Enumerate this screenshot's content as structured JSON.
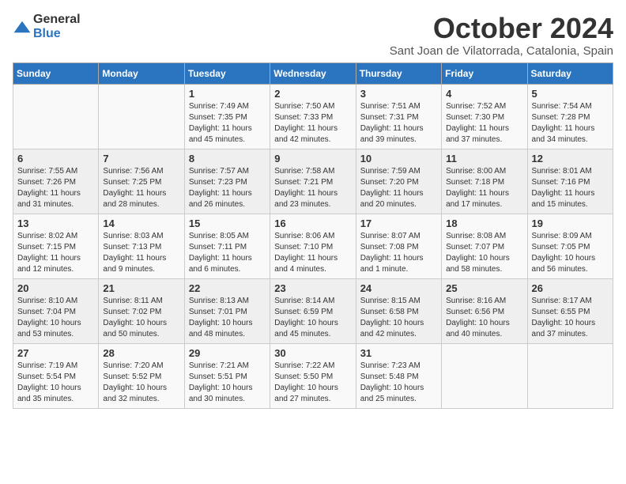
{
  "logo": {
    "general": "General",
    "blue": "Blue"
  },
  "header": {
    "month": "October 2024",
    "location": "Sant Joan de Vilatorrada, Catalonia, Spain"
  },
  "days_of_week": [
    "Sunday",
    "Monday",
    "Tuesday",
    "Wednesday",
    "Thursday",
    "Friday",
    "Saturday"
  ],
  "weeks": [
    [
      {
        "day": "",
        "detail": ""
      },
      {
        "day": "",
        "detail": ""
      },
      {
        "day": "1",
        "detail": "Sunrise: 7:49 AM\nSunset: 7:35 PM\nDaylight: 11 hours and 45 minutes."
      },
      {
        "day": "2",
        "detail": "Sunrise: 7:50 AM\nSunset: 7:33 PM\nDaylight: 11 hours and 42 minutes."
      },
      {
        "day": "3",
        "detail": "Sunrise: 7:51 AM\nSunset: 7:31 PM\nDaylight: 11 hours and 39 minutes."
      },
      {
        "day": "4",
        "detail": "Sunrise: 7:52 AM\nSunset: 7:30 PM\nDaylight: 11 hours and 37 minutes."
      },
      {
        "day": "5",
        "detail": "Sunrise: 7:54 AM\nSunset: 7:28 PM\nDaylight: 11 hours and 34 minutes."
      }
    ],
    [
      {
        "day": "6",
        "detail": "Sunrise: 7:55 AM\nSunset: 7:26 PM\nDaylight: 11 hours and 31 minutes."
      },
      {
        "day": "7",
        "detail": "Sunrise: 7:56 AM\nSunset: 7:25 PM\nDaylight: 11 hours and 28 minutes."
      },
      {
        "day": "8",
        "detail": "Sunrise: 7:57 AM\nSunset: 7:23 PM\nDaylight: 11 hours and 26 minutes."
      },
      {
        "day": "9",
        "detail": "Sunrise: 7:58 AM\nSunset: 7:21 PM\nDaylight: 11 hours and 23 minutes."
      },
      {
        "day": "10",
        "detail": "Sunrise: 7:59 AM\nSunset: 7:20 PM\nDaylight: 11 hours and 20 minutes."
      },
      {
        "day": "11",
        "detail": "Sunrise: 8:00 AM\nSunset: 7:18 PM\nDaylight: 11 hours and 17 minutes."
      },
      {
        "day": "12",
        "detail": "Sunrise: 8:01 AM\nSunset: 7:16 PM\nDaylight: 11 hours and 15 minutes."
      }
    ],
    [
      {
        "day": "13",
        "detail": "Sunrise: 8:02 AM\nSunset: 7:15 PM\nDaylight: 11 hours and 12 minutes."
      },
      {
        "day": "14",
        "detail": "Sunrise: 8:03 AM\nSunset: 7:13 PM\nDaylight: 11 hours and 9 minutes."
      },
      {
        "day": "15",
        "detail": "Sunrise: 8:05 AM\nSunset: 7:11 PM\nDaylight: 11 hours and 6 minutes."
      },
      {
        "day": "16",
        "detail": "Sunrise: 8:06 AM\nSunset: 7:10 PM\nDaylight: 11 hours and 4 minutes."
      },
      {
        "day": "17",
        "detail": "Sunrise: 8:07 AM\nSunset: 7:08 PM\nDaylight: 11 hours and 1 minute."
      },
      {
        "day": "18",
        "detail": "Sunrise: 8:08 AM\nSunset: 7:07 PM\nDaylight: 10 hours and 58 minutes."
      },
      {
        "day": "19",
        "detail": "Sunrise: 8:09 AM\nSunset: 7:05 PM\nDaylight: 10 hours and 56 minutes."
      }
    ],
    [
      {
        "day": "20",
        "detail": "Sunrise: 8:10 AM\nSunset: 7:04 PM\nDaylight: 10 hours and 53 minutes."
      },
      {
        "day": "21",
        "detail": "Sunrise: 8:11 AM\nSunset: 7:02 PM\nDaylight: 10 hours and 50 minutes."
      },
      {
        "day": "22",
        "detail": "Sunrise: 8:13 AM\nSunset: 7:01 PM\nDaylight: 10 hours and 48 minutes."
      },
      {
        "day": "23",
        "detail": "Sunrise: 8:14 AM\nSunset: 6:59 PM\nDaylight: 10 hours and 45 minutes."
      },
      {
        "day": "24",
        "detail": "Sunrise: 8:15 AM\nSunset: 6:58 PM\nDaylight: 10 hours and 42 minutes."
      },
      {
        "day": "25",
        "detail": "Sunrise: 8:16 AM\nSunset: 6:56 PM\nDaylight: 10 hours and 40 minutes."
      },
      {
        "day": "26",
        "detail": "Sunrise: 8:17 AM\nSunset: 6:55 PM\nDaylight: 10 hours and 37 minutes."
      }
    ],
    [
      {
        "day": "27",
        "detail": "Sunrise: 7:19 AM\nSunset: 5:54 PM\nDaylight: 10 hours and 35 minutes."
      },
      {
        "day": "28",
        "detail": "Sunrise: 7:20 AM\nSunset: 5:52 PM\nDaylight: 10 hours and 32 minutes."
      },
      {
        "day": "29",
        "detail": "Sunrise: 7:21 AM\nSunset: 5:51 PM\nDaylight: 10 hours and 30 minutes."
      },
      {
        "day": "30",
        "detail": "Sunrise: 7:22 AM\nSunset: 5:50 PM\nDaylight: 10 hours and 27 minutes."
      },
      {
        "day": "31",
        "detail": "Sunrise: 7:23 AM\nSunset: 5:48 PM\nDaylight: 10 hours and 25 minutes."
      },
      {
        "day": "",
        "detail": ""
      },
      {
        "day": "",
        "detail": ""
      }
    ]
  ]
}
